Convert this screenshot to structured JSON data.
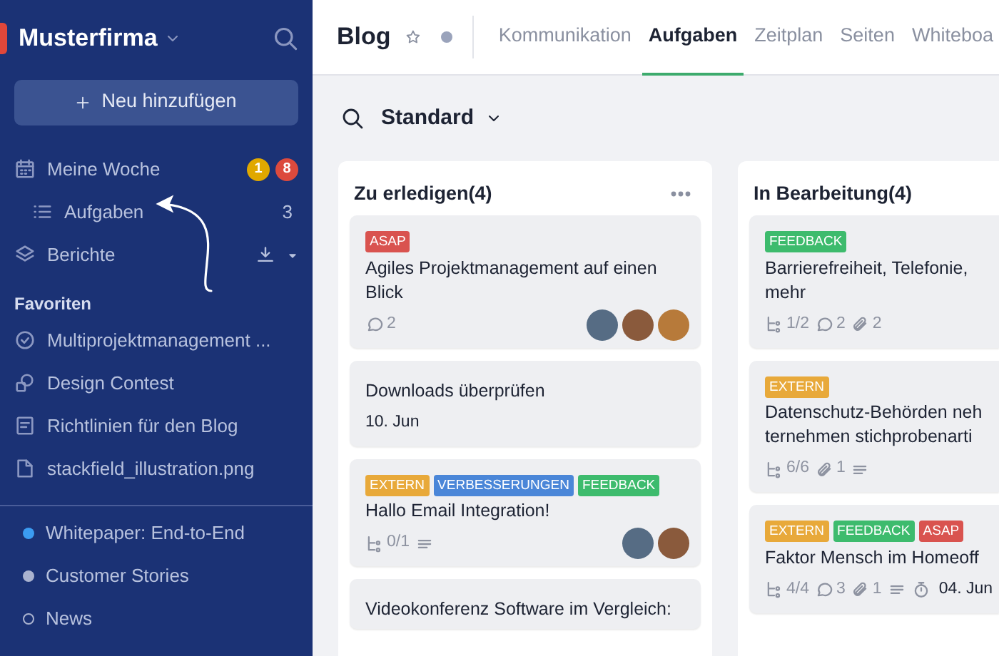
{
  "sidebar": {
    "workspace": "Musterfirma",
    "new_button": "Neu hinzufügen",
    "nav": [
      {
        "kind": "week",
        "label": "Meine Woche",
        "badges": [
          {
            "text": "1",
            "color": "#e0a800"
          },
          {
            "text": "8",
            "color": "#dc4a3d"
          }
        ]
      },
      {
        "kind": "tasks",
        "label": "Aufgaben",
        "count": "3"
      },
      {
        "kind": "reports",
        "label": "Berichte"
      }
    ],
    "favorites_heading": "Favoriten",
    "favorites": [
      {
        "kind": "check",
        "label": "Multiprojektmanagement ..."
      },
      {
        "kind": "shapes",
        "label": "Design Contest"
      },
      {
        "kind": "page",
        "label": "Richtlinien für den Blog"
      },
      {
        "kind": "file",
        "label": "stackfield_illustration.png"
      }
    ],
    "channels": [
      {
        "label": "Whitepaper: End-to-End",
        "kind": "filled",
        "color": "#3b9cf2"
      },
      {
        "label": "Customer Stories",
        "kind": "filled",
        "color": "#aab3cf"
      },
      {
        "label": "News",
        "kind": "hollow",
        "color": "#aab3cf"
      }
    ]
  },
  "header": {
    "title": "Blog",
    "tabs": [
      {
        "label": "Kommunikation",
        "selected": false
      },
      {
        "label": "Aufgaben",
        "selected": true
      },
      {
        "label": "Zeitplan",
        "selected": false
      },
      {
        "label": "Seiten",
        "selected": false
      },
      {
        "label": "Whiteboa",
        "selected": false
      }
    ]
  },
  "board": {
    "view": "Standard",
    "columns": [
      {
        "title": "Zu erledigen(4)",
        "menu": true,
        "cards": [
          {
            "tags": [
              {
                "text": "ASAP",
                "color": "#d9534f"
              }
            ],
            "lines": [
              "Agiles Projektmanagement auf einen Blick"
            ],
            "meta": [
              {
                "kind": "comments",
                "text": "2"
              }
            ],
            "avatars": [
              {
                "kind": "photo"
              },
              {
                "kind": "photo"
              },
              {
                "kind": "photo"
              }
            ]
          },
          {
            "lines": [
              "Downloads überprüfen"
            ],
            "meta": [
              {
                "kind": "date",
                "text": "10. Jun"
              }
            ]
          },
          {
            "tags": [
              {
                "text": "EXTERN",
                "color": "#e8a93a"
              },
              {
                "text": "VERBESSERUNGEN",
                "color": "#4a86d8"
              },
              {
                "text": "FEEDBACK",
                "color": "#3dbb6d"
              }
            ],
            "lines": [
              "Hallo Email Integration!"
            ],
            "meta": [
              {
                "kind": "subtasks",
                "text": "0/1"
              },
              {
                "kind": "description"
              }
            ],
            "avatars": [
              {
                "kind": "photo"
              },
              {
                "kind": "photo"
              }
            ]
          },
          {
            "lines": [
              "Videokonferenz Software im Vergleich:"
            ]
          }
        ]
      },
      {
        "title": "In Bearbeitung(4)",
        "menu": false,
        "cards": [
          {
            "tags": [
              {
                "text": "FEEDBACK",
                "color": "#3dbb6d"
              }
            ],
            "lines": [
              "Barrierefreiheit, Telefonie,",
              "mehr"
            ],
            "meta": [
              {
                "kind": "subtasks",
                "text": "1/2"
              },
              {
                "kind": "comments",
                "text": "2"
              },
              {
                "kind": "attachments",
                "text": "2"
              }
            ]
          },
          {
            "tags": [
              {
                "text": "EXTERN",
                "color": "#e8a93a"
              }
            ],
            "lines": [
              "Datenschutz-Behörden neh",
              "ternehmen stichprobenarti"
            ],
            "meta": [
              {
                "kind": "subtasks",
                "text": "6/6"
              },
              {
                "kind": "attachments",
                "text": "1"
              },
              {
                "kind": "description"
              }
            ]
          },
          {
            "tags": [
              {
                "text": "EXTERN",
                "color": "#e8a93a"
              },
              {
                "text": "FEEDBACK",
                "color": "#3dbb6d"
              },
              {
                "text": "ASAP",
                "color": "#d9534f"
              }
            ],
            "lines": [
              "Faktor Mensch im Homeoff"
            ],
            "meta": [
              {
                "kind": "subtasks",
                "text": "4/4"
              },
              {
                "kind": "comments",
                "text": "3"
              },
              {
                "kind": "attachments",
                "text": "1"
              },
              {
                "kind": "description"
              },
              {
                "kind": "due",
                "text": "04. Jun"
              }
            ]
          }
        ]
      }
    ]
  }
}
